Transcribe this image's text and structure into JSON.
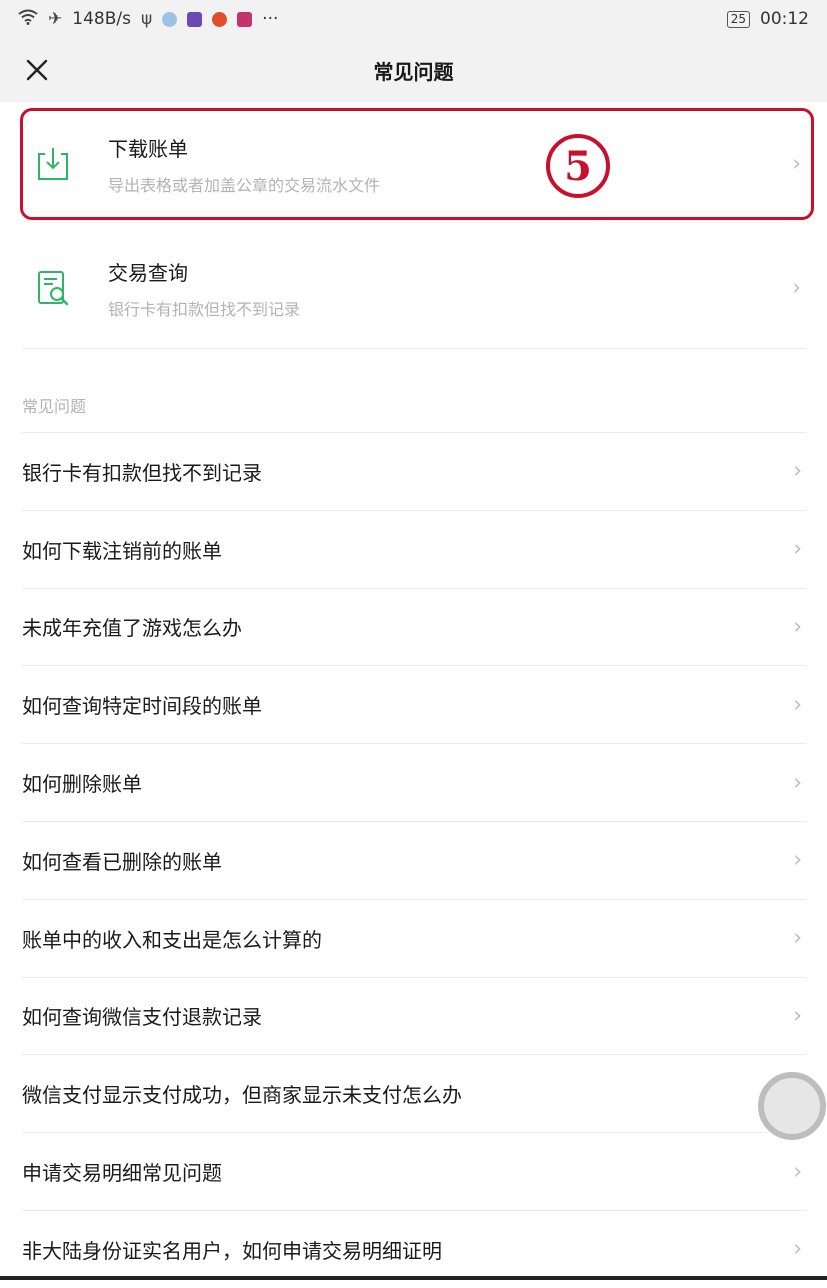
{
  "status_bar": {
    "speed": "148B/s",
    "battery": "25",
    "time": "00:12",
    "more": "···"
  },
  "nav": {
    "title": "常见问题",
    "close_icon": "close-icon"
  },
  "cards": [
    {
      "title": "下载账单",
      "subtitle": "导出表格或者加盖公章的交易流水文件",
      "icon": "download-icon"
    },
    {
      "title": "交易查询",
      "subtitle": "银行卡有扣款但找不到记录",
      "icon": "search-document-icon"
    }
  ],
  "annotation": {
    "badge": "5",
    "color": "#c8102e"
  },
  "section_label": "常见问题",
  "faq_items": [
    "银行卡有扣款但找不到记录",
    "如何下载注销前的账单",
    "未成年充值了游戏怎么办",
    "如何查询特定时间段的账单",
    "如何删除账单",
    "如何查看已删除的账单",
    "账单中的收入和支出是怎么计算的",
    "如何查询微信支付退款记录",
    "微信支付显示支付成功，但商家显示未支付怎么办",
    "申请交易明细常见问题",
    "非大陆身份证实名用户，如何申请交易明细证明"
  ],
  "colors": {
    "accent_green": "#2fb566",
    "highlight_red": "#c8102e"
  }
}
